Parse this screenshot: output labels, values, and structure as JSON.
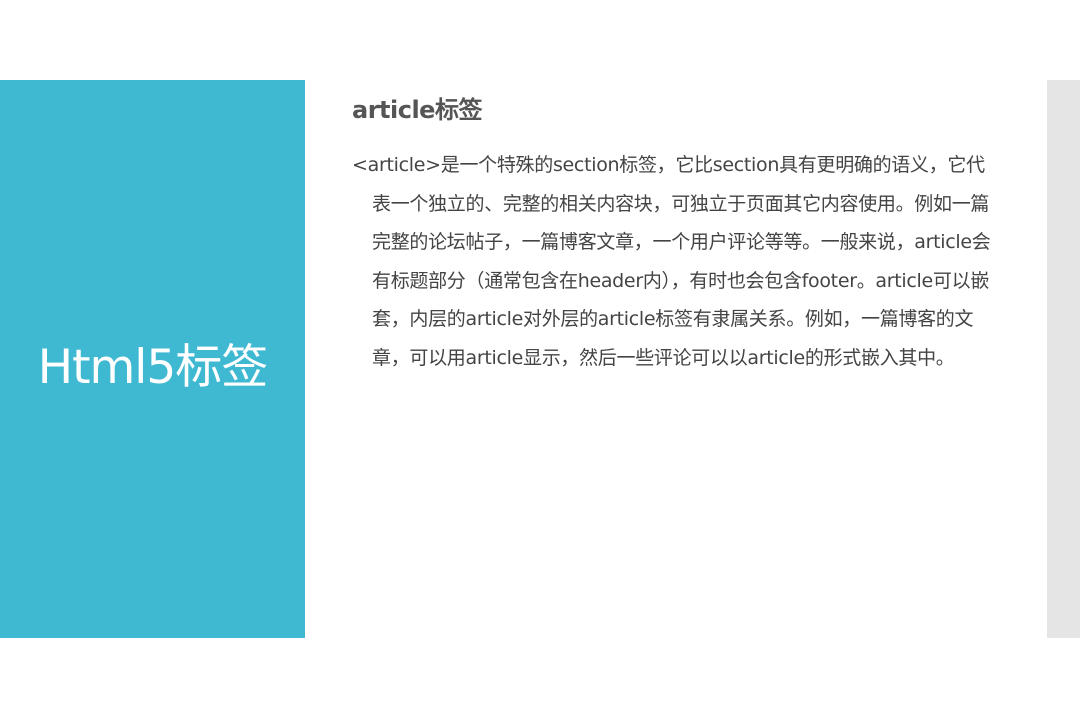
{
  "slide": {
    "side_title": "Html5标签",
    "heading": "article标签",
    "body": "<article>是一个特殊的section标签，它比section具有更明确的语义，它代表一个独立的、完整的相关内容块，可独立于页面其它内容使用。例如一篇完整的论坛帖子，一篇博客文章，一个用户评论等等。一般来说，article会有标题部分（通常包含在header内），有时也会包含footer。article可以嵌套，内层的article对外层的article标签有隶属关系。例如，一篇博客的文章，可以用article显示，然后一些评论可以以article的形式嵌入其中。"
  },
  "colors": {
    "accent": "#3fb9d2",
    "side_strip": "#e5e5e5",
    "heading_text": "#555555",
    "body_text": "#444444",
    "title_text": "#ffffff"
  }
}
